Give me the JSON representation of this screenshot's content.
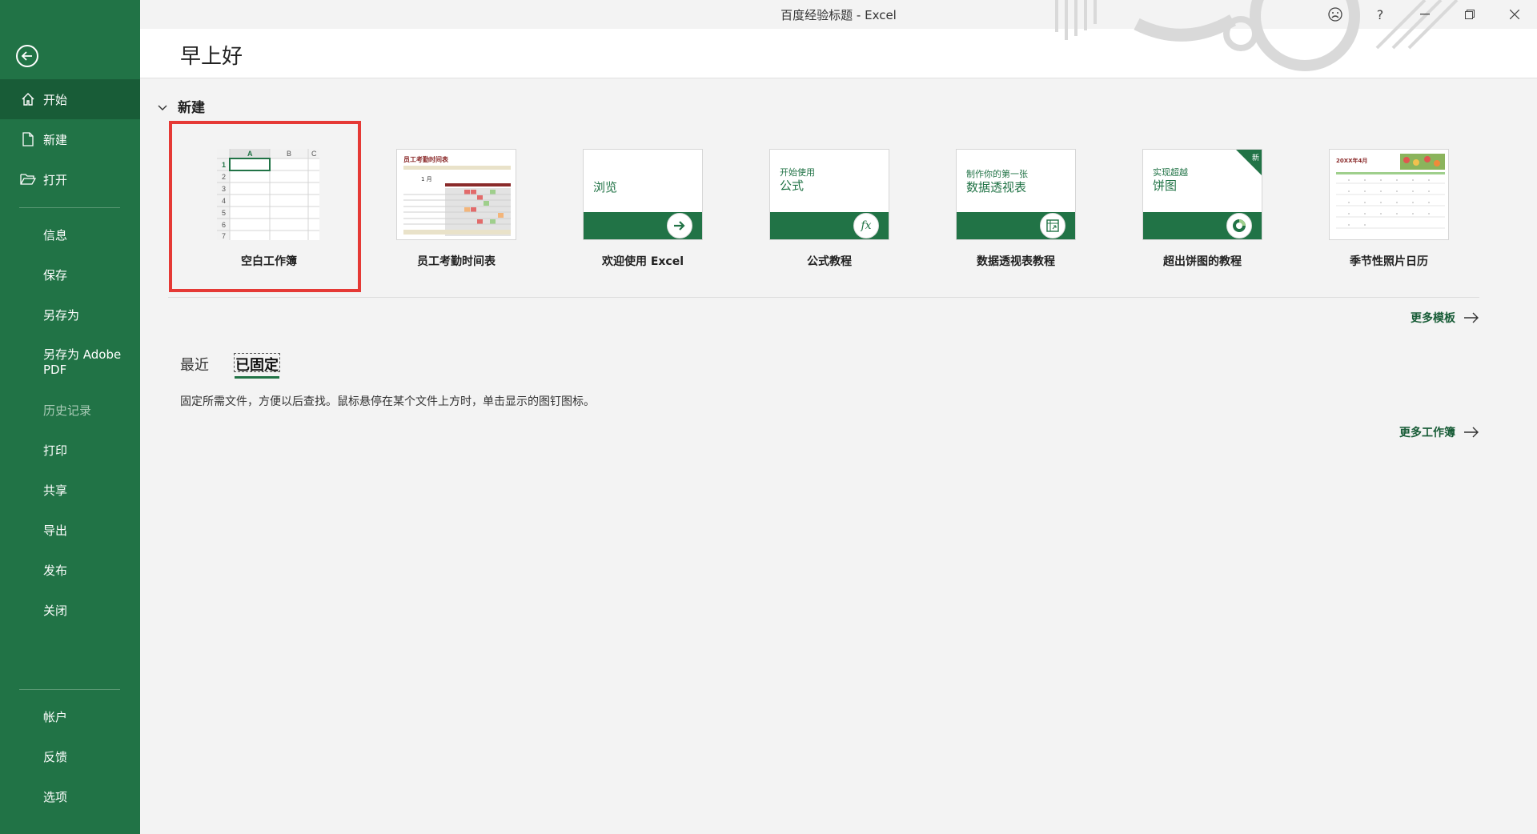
{
  "window": {
    "title": "百度经验标题  -  Excel"
  },
  "sidebar": {
    "items": [
      {
        "label": "开始"
      },
      {
        "label": "新建"
      },
      {
        "label": "打开"
      },
      {
        "label": "信息"
      },
      {
        "label": "保存"
      },
      {
        "label": "另存为"
      },
      {
        "label": "另存为 Adobe PDF"
      },
      {
        "label": "历史记录"
      },
      {
        "label": "打印"
      },
      {
        "label": "共享"
      },
      {
        "label": "导出"
      },
      {
        "label": "发布"
      },
      {
        "label": "关闭"
      },
      {
        "label": "帐户"
      },
      {
        "label": "反馈"
      },
      {
        "label": "选项"
      }
    ]
  },
  "header": {
    "greeting": "早上好"
  },
  "new_section": {
    "title": "新建",
    "templates": [
      {
        "name": "空白工作簿"
      },
      {
        "name": "员工考勤时间表",
        "thumb_title": "员工考勤时间表",
        "thumb_month": "1 月"
      },
      {
        "name": "欢迎使用 Excel",
        "thumb_text": "浏览"
      },
      {
        "name": "公式教程",
        "thumb_line1": "开始使用",
        "thumb_line2": "公式",
        "thumb_icon": "fx"
      },
      {
        "name": "数据透视表教程",
        "thumb_line1": "制作你的第一张",
        "thumb_line2": "数据透视表"
      },
      {
        "name": "超出饼图的教程",
        "thumb_line1": "实现超越",
        "thumb_line2": "饼图",
        "badge": "新"
      },
      {
        "name": "季节性照片日历",
        "thumb_title": "20XX年4月"
      }
    ],
    "more_templates": "更多模板"
  },
  "files": {
    "tabs": [
      {
        "label": "最近"
      },
      {
        "label": "已固定"
      }
    ],
    "pinned_message": "固定所需文件，方便以后查找。鼠标悬停在某个文件上方时，单击显示的图钉图标。",
    "more_workbooks": "更多工作簿"
  },
  "colors": {
    "brand": "#217346",
    "brand_dark": "#185c37",
    "highlight": "#e53935"
  }
}
